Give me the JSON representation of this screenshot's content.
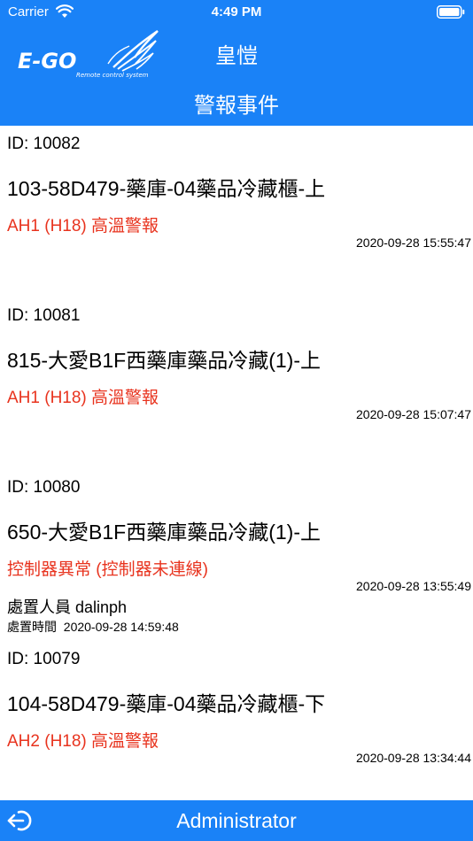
{
  "status_bar": {
    "carrier": "Carrier",
    "time": "4:49 PM"
  },
  "header": {
    "logo_text": "E-GO",
    "logo_subtext": "Remote control system",
    "title": "皇愷",
    "subtitle": "警報事件"
  },
  "events": [
    {
      "id": "ID: 10082",
      "device": "103-58D479-藥庫-04藥品冷藏櫃-上",
      "alarm": "AH1 (H18) 高溫警報",
      "timestamp": "2020-09-28 15:55:47"
    },
    {
      "id": "ID: 10081",
      "device": "815-大愛B1F西藥庫藥品冷藏(1)-上",
      "alarm": "AH1 (H18) 高溫警報",
      "timestamp": "2020-09-28 15:07:47"
    },
    {
      "id": "ID: 10080",
      "device": "650-大愛B1F西藥庫藥品冷藏(1)-上",
      "alarm": "控制器異常 (控制器未連線)",
      "timestamp": "2020-09-28 13:55:49",
      "handler": "處置人員 dalinph",
      "handled_label": "處置時間",
      "handled_time": "2020-09-28 14:59:48"
    },
    {
      "id": "ID: 10079",
      "device": "104-58D479-藥庫-04藥品冷藏櫃-下",
      "alarm": "AH2 (H18) 高溫警報",
      "timestamp": "2020-09-28 13:34:44"
    }
  ],
  "footer": {
    "user": "Administrator"
  },
  "colors": {
    "accent": "#1a82f7",
    "alarm": "#e8331e"
  }
}
